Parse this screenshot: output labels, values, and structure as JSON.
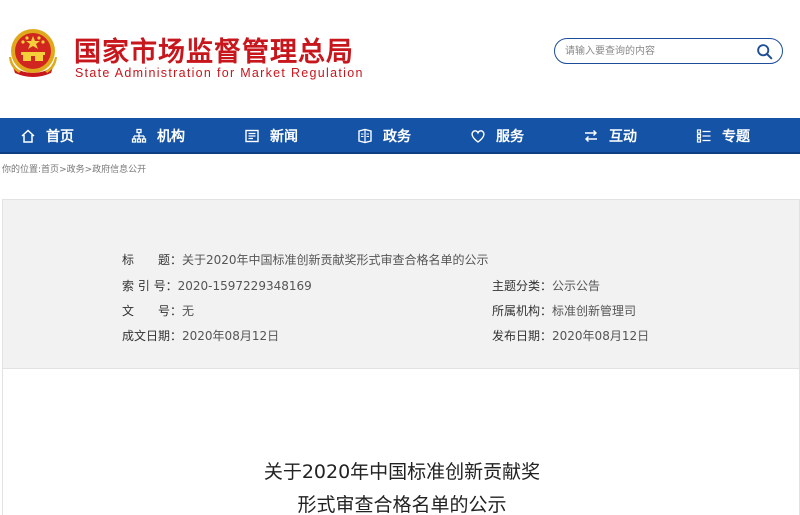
{
  "header": {
    "title_cn": "国家市场监督管理总局",
    "title_en": "State Administration for Market Regulation",
    "emblem_icon": "national-emblem-icon"
  },
  "search": {
    "placeholder": "请输入要查询的内容",
    "icon": "search-icon"
  },
  "nav": {
    "items": [
      {
        "label": "首页",
        "icon": "home-icon"
      },
      {
        "label": "机构",
        "icon": "org-chart-icon"
      },
      {
        "label": "新闻",
        "icon": "newspaper-icon"
      },
      {
        "label": "政务",
        "icon": "government-icon"
      },
      {
        "label": "服务",
        "icon": "heart-icon"
      },
      {
        "label": "互动",
        "icon": "exchange-icon"
      },
      {
        "label": "专题",
        "icon": "topic-list-icon"
      }
    ]
  },
  "breadcrumb": {
    "prefix": "你的位置:",
    "items": [
      "首页",
      "政务",
      "政府信息公开"
    ],
    "separator": ">"
  },
  "info": {
    "title_label": "标　　题：",
    "title_value": "关于2020年中国标准创新贡献奖形式审查合格名单的公示",
    "index_label": "索 引 号：",
    "index_value": "2020-1597229348169",
    "topic_label": "主题分类：",
    "topic_value": "公示公告",
    "docno_label": "文　　号：",
    "docno_value": "无",
    "agency_label": "所属机构：",
    "agency_value": "标准创新管理司",
    "created_label": "成文日期：",
    "created_value": "2020年08月12日",
    "published_label": "发布日期：",
    "published_value": "2020年08月12日"
  },
  "article": {
    "title_line1": "关于2020年中国标准创新贡献奖",
    "title_line2": "形式审查合格名单的公示"
  },
  "colors": {
    "brand_red": "#c8161d",
    "nav_blue": "#1453a6",
    "search_border": "#1c4e9a"
  }
}
